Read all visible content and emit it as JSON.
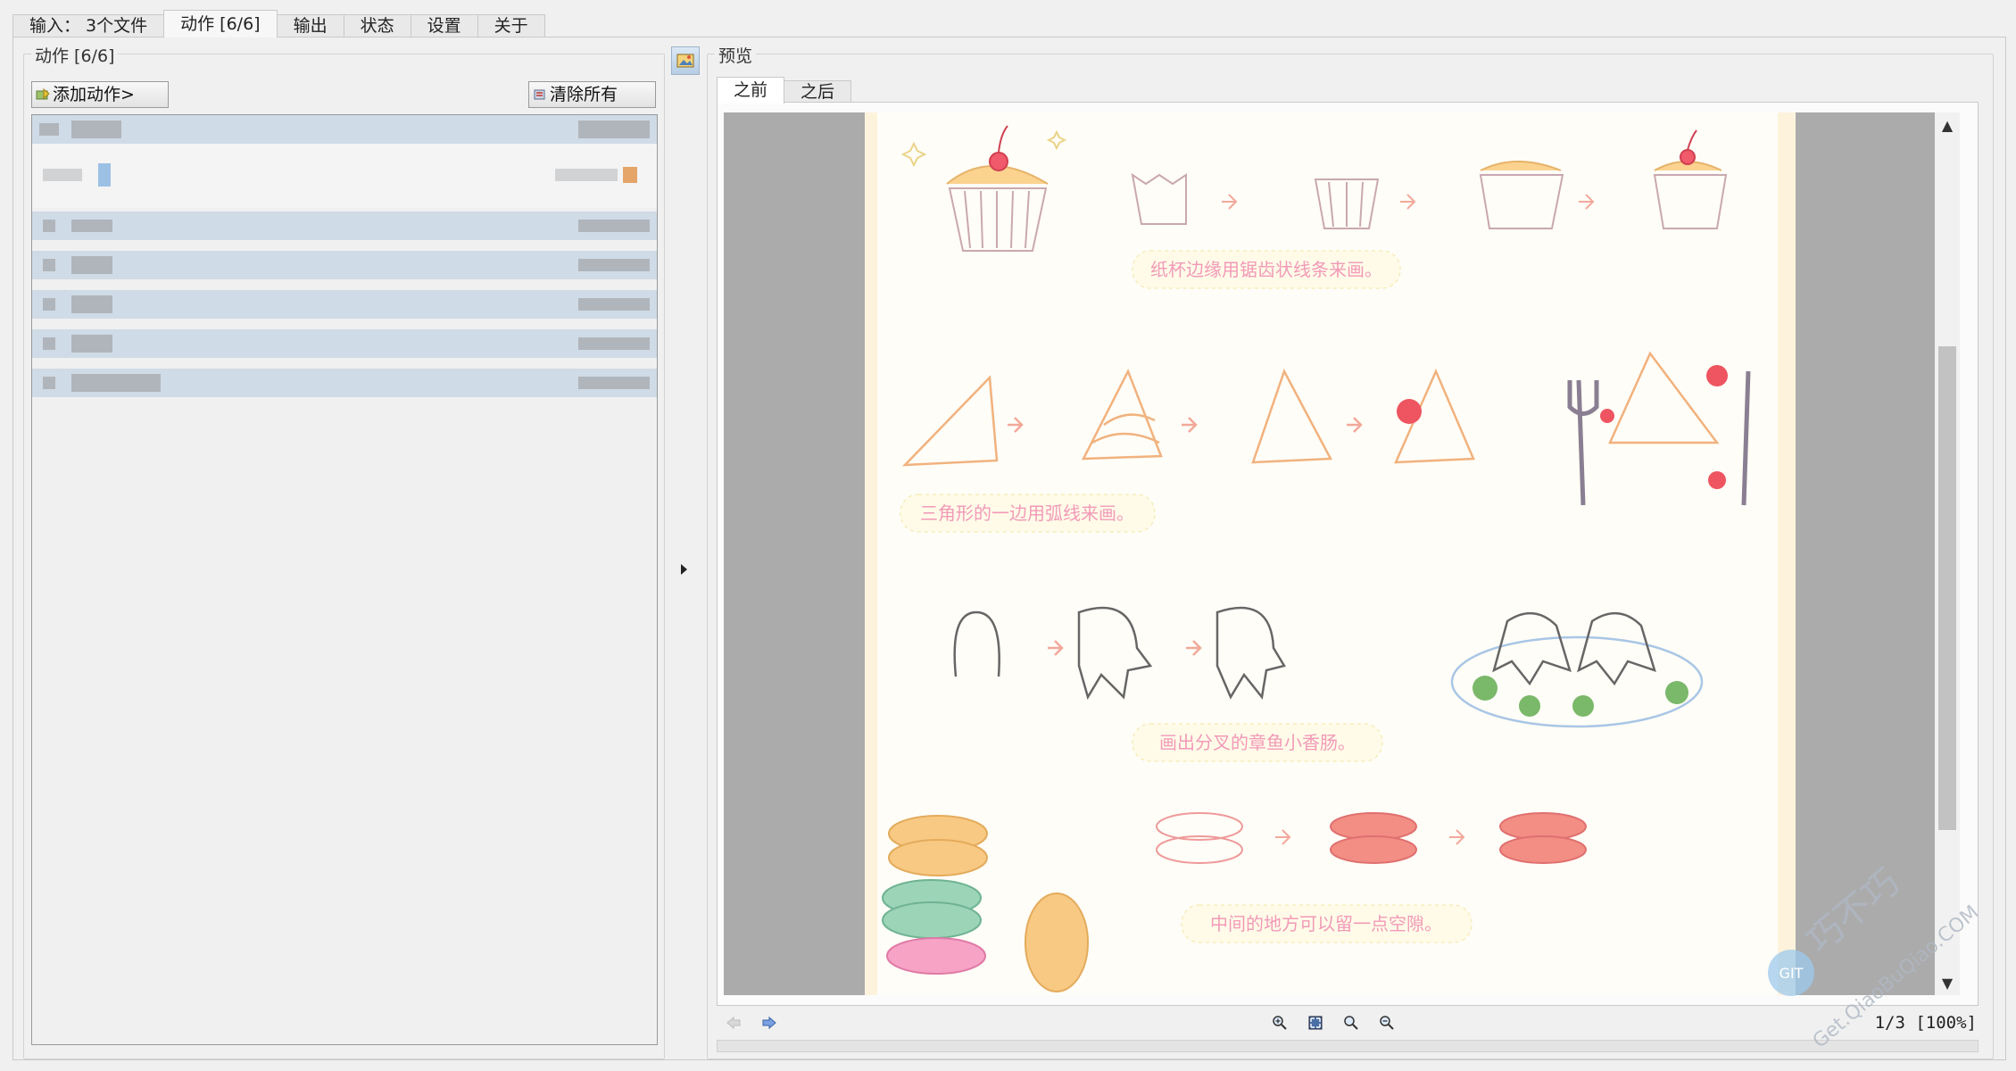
{
  "tabs": [
    {
      "label": "输入：  3个文件"
    },
    {
      "label": "动作 [6/6]"
    },
    {
      "label": "输出"
    },
    {
      "label": "状态"
    },
    {
      "label": "设置"
    },
    {
      "label": "关于"
    }
  ],
  "actions_group": {
    "legend": "动作 [6/6]",
    "add_button": "添加动作>",
    "clear_button": "清除所有"
  },
  "preview_group": {
    "legend": "预览",
    "subtabs": [
      {
        "label": "之前"
      },
      {
        "label": "之后"
      }
    ]
  },
  "preview_page": {
    "caption1": "纸杯边缘用锯齿状线条来画。",
    "caption2": "三角形的一边用弧线来画。",
    "caption3": "画出分叉的章鱼小香肠。",
    "caption4": "中间的地方可以留一点空隙。"
  },
  "toolbar": {
    "page_counter": "1/3 [100%]"
  },
  "watermark": {
    "badge": "GIT",
    "cn": "巧不巧",
    "url": "Get.QiaoBuQiao.COM"
  },
  "colors": {
    "selection_row": "#cfdbe6",
    "preview_bg": "#ababab",
    "page_bg": "#fffdf7"
  }
}
